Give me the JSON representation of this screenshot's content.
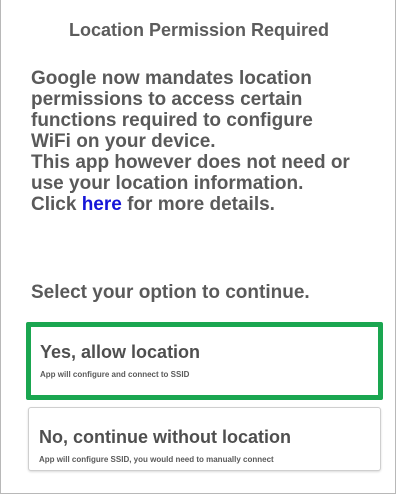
{
  "dialog": {
    "title": "Location Permission Required",
    "body_lines": [
      "Google now mandates location",
      "permissions to access certain",
      "functions required to configure",
      "WiFi on your device.",
      "This app however does not need or",
      "use your location information."
    ],
    "click_prefix": "Click ",
    "link_text": "here",
    "click_suffix": " for more details.",
    "prompt": "Select your option to continue."
  },
  "options": [
    {
      "title": "Yes, allow location",
      "subtitle": "App will configure and connect to SSID",
      "selected": true
    },
    {
      "title": "No, continue without location",
      "subtitle": "App will configure SSID, you would need to manually connect",
      "selected": false
    }
  ],
  "colors": {
    "selected_border": "#1aa650",
    "link": "#1515d8",
    "text": "#5a5a5a"
  }
}
